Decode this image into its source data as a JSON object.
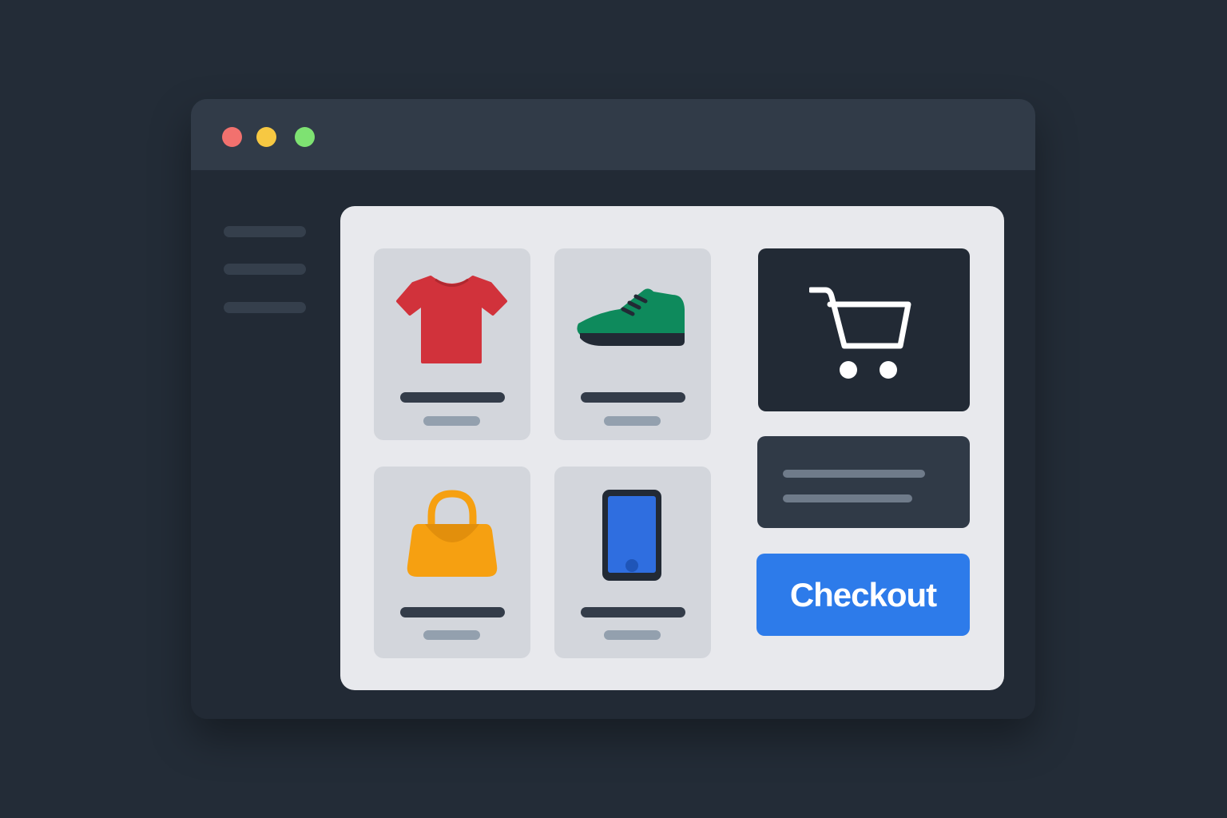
{
  "window": {
    "controls": {
      "close_color": "#f2716e",
      "minimize_color": "#f7c842",
      "maximize_color": "#7ee272"
    }
  },
  "sidebar": {
    "items": [
      "menu-line",
      "menu-line",
      "menu-line"
    ]
  },
  "products": [
    {
      "icon": "t-shirt-icon",
      "color": "#d1323b"
    },
    {
      "icon": "sneaker-icon",
      "color": "#0e8a5c"
    },
    {
      "icon": "handbag-icon",
      "color": "#f6a011"
    },
    {
      "icon": "smartphone-icon",
      "color": "#2f6ee0"
    }
  ],
  "cart": {
    "icon": "shopping-cart-icon"
  },
  "checkout": {
    "label": "Checkout",
    "color": "#2d7bea"
  }
}
